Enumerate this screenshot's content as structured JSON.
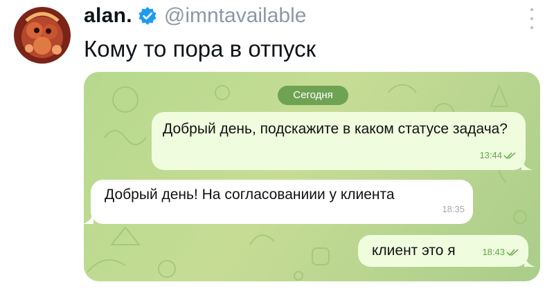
{
  "tweet": {
    "display_name": "alan.",
    "handle": "@imntavailable",
    "text": "Кому то пора в отпуск",
    "verified_icon": "verified-badge-icon",
    "accent_color": "#1d9bf0"
  },
  "chat": {
    "date_label": "Сегодня",
    "messages": [
      {
        "direction": "outgoing",
        "text": "Добрый день, подскажите в каком статусе задача?",
        "time": "13:44",
        "status_icon": "double-check-icon"
      },
      {
        "direction": "incoming",
        "text": "Добрый день! На согласованиии у клиента",
        "time": "18:35"
      },
      {
        "direction": "outgoing",
        "text": "клиент это я",
        "time": "18:43",
        "status_icon": "double-check-icon"
      }
    ],
    "colors": {
      "background": "#bcd98f",
      "outgoing_bubble": "#effdde",
      "incoming_bubble": "#ffffff",
      "date_pill": "#6fa354"
    }
  }
}
